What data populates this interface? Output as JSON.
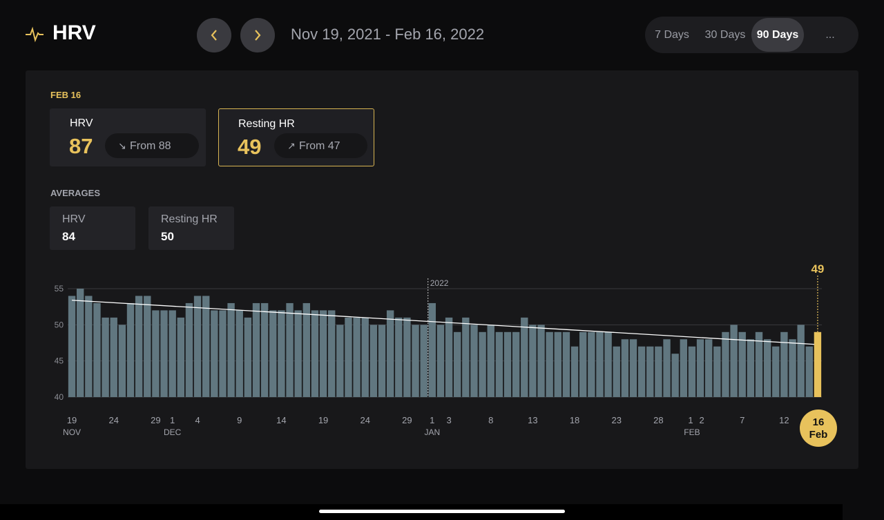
{
  "header": {
    "title": "HRV",
    "icon": "pulse-icon",
    "prev_icon": "chevron-left-icon",
    "next_icon": "chevron-right-icon",
    "date_range": "Nov 19, 2021 - Feb 16, 2022",
    "ranges": [
      {
        "label": "7 Days",
        "active": false
      },
      {
        "label": "30 Days",
        "active": false
      },
      {
        "label": "90 Days",
        "active": true
      },
      {
        "label": "...",
        "active": false
      }
    ]
  },
  "selected": {
    "date_label": "FEB 16",
    "cards": [
      {
        "label": "HRV",
        "value": "87",
        "change": "From 88",
        "trend_icon": "arrow-down-right-icon",
        "arrow": "↘",
        "selected": false
      },
      {
        "label": "Resting HR",
        "value": "49",
        "change": "From 47",
        "trend_icon": "arrow-up-right-icon",
        "arrow": "↗",
        "selected": true
      }
    ]
  },
  "averages": {
    "label": "AVERAGES",
    "cards": [
      {
        "label": "HRV",
        "value": "84"
      },
      {
        "label": "Resting HR",
        "value": "50"
      }
    ]
  },
  "colors": {
    "accent": "#e8c25c",
    "bar": "#617780",
    "background": "#18181a"
  },
  "chart_data": {
    "type": "bar",
    "x_range": [
      "2021-11-19",
      "2022-02-16"
    ],
    "interval": "daily",
    "values": [
      54,
      55,
      54,
      53,
      51,
      51,
      50,
      53,
      54,
      54,
      52,
      52,
      52,
      51,
      53,
      54,
      54,
      52,
      52,
      53,
      52,
      51,
      53,
      53,
      52,
      52,
      53,
      52,
      53,
      52,
      52,
      52,
      50,
      51,
      51,
      51,
      50,
      50,
      52,
      51,
      51,
      50,
      50,
      53,
      50,
      51,
      49,
      51,
      50,
      49,
      50,
      49,
      49,
      49,
      51,
      50,
      50,
      49,
      49,
      49,
      47,
      49,
      49,
      49,
      49,
      47,
      48,
      48,
      47,
      47,
      47,
      48,
      46,
      48,
      47,
      48,
      48,
      47,
      49,
      50,
      49,
      48,
      49,
      48,
      47,
      49,
      48,
      50,
      47,
      49
    ],
    "ylim": [
      40,
      55
    ],
    "yticks": [
      40,
      45,
      50,
      55
    ],
    "grid": true,
    "trendline": [
      53.4,
      47.3
    ],
    "year_marker": {
      "label": "2022",
      "index": 43
    },
    "highlight": {
      "index": 89,
      "value_label": "49",
      "day": "16",
      "month": "Feb"
    },
    "xticks": [
      {
        "index": 0,
        "day": "19",
        "month": "NOV"
      },
      {
        "index": 5,
        "day": "24"
      },
      {
        "index": 10,
        "day": "29"
      },
      {
        "index": 12,
        "day": "1",
        "month": "DEC"
      },
      {
        "index": 15,
        "day": "4"
      },
      {
        "index": 20,
        "day": "9"
      },
      {
        "index": 25,
        "day": "14"
      },
      {
        "index": 30,
        "day": "19"
      },
      {
        "index": 35,
        "day": "24"
      },
      {
        "index": 40,
        "day": "29"
      },
      {
        "index": 43,
        "day": "1",
        "month": "JAN"
      },
      {
        "index": 45,
        "day": "3"
      },
      {
        "index": 50,
        "day": "8"
      },
      {
        "index": 55,
        "day": "13"
      },
      {
        "index": 60,
        "day": "18"
      },
      {
        "index": 65,
        "day": "23"
      },
      {
        "index": 70,
        "day": "28"
      },
      {
        "index": 74,
        "day": "1",
        "month": "FEB"
      },
      {
        "index": 75,
        "day": "2"
      },
      {
        "index": 80,
        "day": "7"
      },
      {
        "index": 85,
        "day": "12"
      }
    ]
  }
}
